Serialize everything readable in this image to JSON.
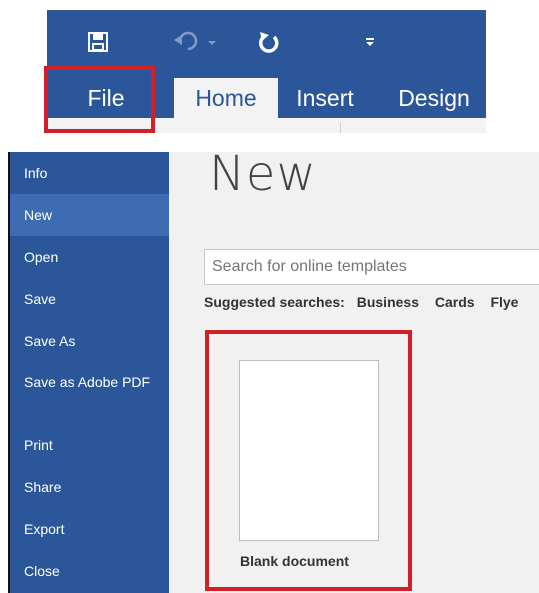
{
  "ribbon": {
    "quick_access": {
      "save_icon": "save-icon",
      "undo_icon": "undo-icon",
      "redo_icon": "redo-icon",
      "customize_icon": "customize-qat-icon"
    },
    "tabs": [
      {
        "label": "File"
      },
      {
        "label": "Home"
      },
      {
        "label": "Insert"
      },
      {
        "label": "Design"
      }
    ],
    "colors": {
      "accent": "#2b579a",
      "highlight": "#d0212a"
    }
  },
  "sidebar": {
    "items": [
      {
        "label": "Info"
      },
      {
        "label": "New"
      },
      {
        "label": "Open"
      },
      {
        "label": "Save"
      },
      {
        "label": "Save As"
      },
      {
        "label": "Save as Adobe PDF"
      },
      {
        "label": "Print"
      },
      {
        "label": "Share"
      },
      {
        "label": "Export"
      },
      {
        "label": "Close"
      }
    ]
  },
  "main": {
    "title": "New",
    "search": {
      "placeholder": "Search for online templates"
    },
    "suggested": {
      "label": "Suggested searches:",
      "items": [
        "Business",
        "Cards",
        "Flye"
      ]
    },
    "templates": [
      {
        "label": "Blank document"
      }
    ]
  }
}
